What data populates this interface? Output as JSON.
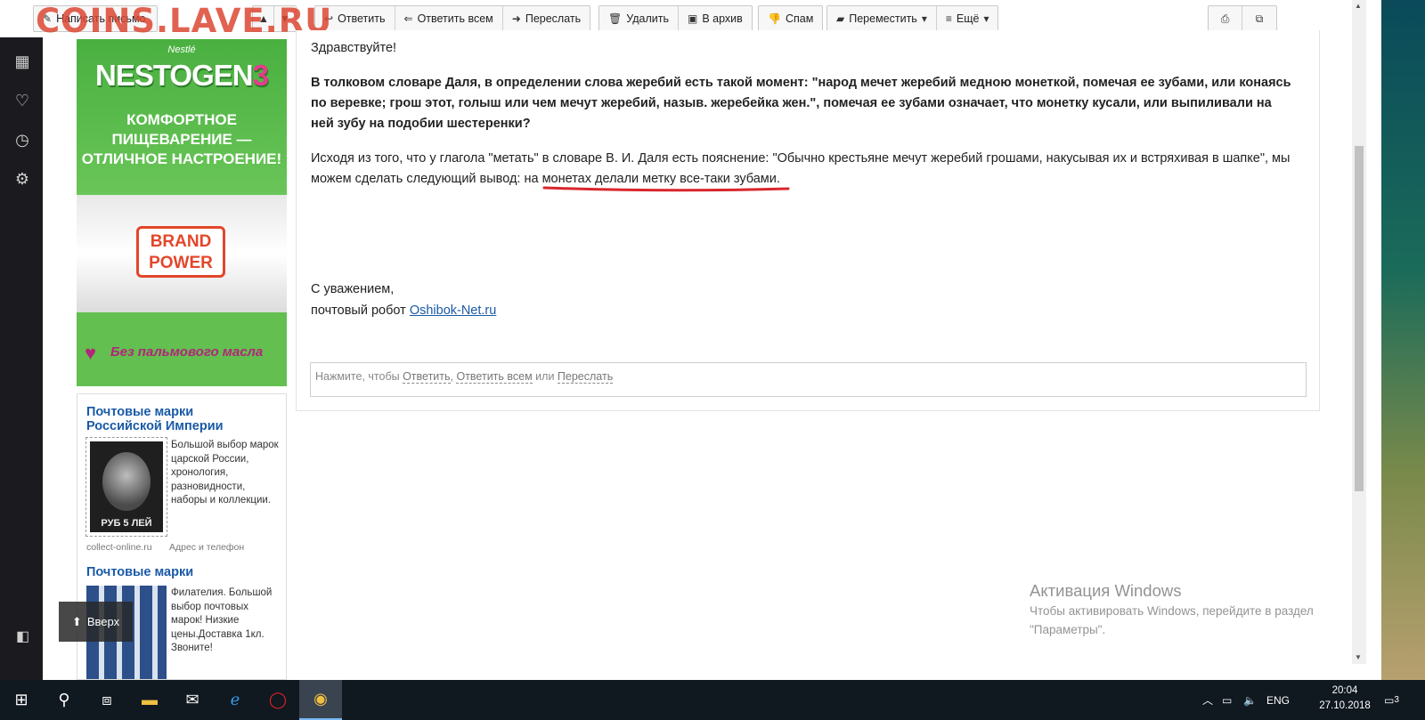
{
  "watermark": "COINS.LAVE.RU",
  "toolbar": {
    "compose": "Написать письмо",
    "reply": "Ответить",
    "reply_all": "Ответить всем",
    "forward": "Переслать",
    "delete": "Удалить",
    "archive": "В архив",
    "spam": "Спам",
    "move": "Переместить",
    "more": "Ещё"
  },
  "ad_nestle": {
    "brand": "Nestlé",
    "logo": "NESTOGEN",
    "logo_num": "3",
    "slogan_1": "КОМФОРТНОЕ",
    "slogan_2": "ПИЩЕВАРЕНИЕ —",
    "slogan_3": "ОТЛИЧНОЕ НАСТРОЕНИЕ!",
    "badge_1": "BRAND",
    "badge_2": "POWER",
    "bottom": "Без пальмового масла"
  },
  "ad_stamps": {
    "title_1": "Почтовые марки Российской Империи",
    "text_1": "Большой выбор марок царской России, хронология, разновидности, наборы и коллекции.",
    "stamp_value": "РУБ 5 ЛЕЙ",
    "domain_1": "collect-online.ru",
    "address_1": "Адрес и телефон",
    "title_2": "Почтовые марки",
    "text_2": "Филателия. Большой выбор почтовых марок! Низкие цены.Доставка 1кл. Звоните!"
  },
  "up_button": "Вверх",
  "letter": {
    "greeting": "Здравствуйте!",
    "para_bold_1": "В толковом словаре Даля, в определении слова жеребий есть такой момент: \"народ мечет жеребий медною монеткой, помечая ее зубами, или конаясь",
    "para_bold_2": "по веревке; грош этот, голыш или чем мечут жеребий, назыв. жеребейка жен.\", помечая ее зубами означает, что монетку кусали, или выпиливали на",
    "para_bold_3": "ней зубу на подобии шестеренки?",
    "para_1": "Исходя из того, что у глагола \"метать\" в словаре В. И. Даля есть пояснение: \"Обычно крестьяне мечут жеребий грошами, накусывая их и встряхивая в шапке\", мы",
    "para_2": "можем сделать следующий вывод: на монетах делали метку все-таки зубами.",
    "regards": "С уважением,",
    "robot": "почтовый робот",
    "robot_link": "Oshibok-Net.ru"
  },
  "reply_box": {
    "prefix": "Нажмите, чтобы",
    "reply": "Ответить",
    "comma": ",",
    "reply_all": "Ответить всем",
    "or": "или",
    "forward": "Переслать"
  },
  "activation": {
    "title": "Активация Windows",
    "line_1": "Чтобы активировать Windows, перейдите в раздел",
    "line_2": "\"Параметры\"."
  },
  "taskbar": {
    "lang": "ENG",
    "time": "20:04",
    "date": "27.10.2018",
    "notifications": "3"
  },
  "colors": {
    "accent_red": "#d9262c",
    "link": "#1a5aa6",
    "nestle_green": "#5fbf4e"
  }
}
